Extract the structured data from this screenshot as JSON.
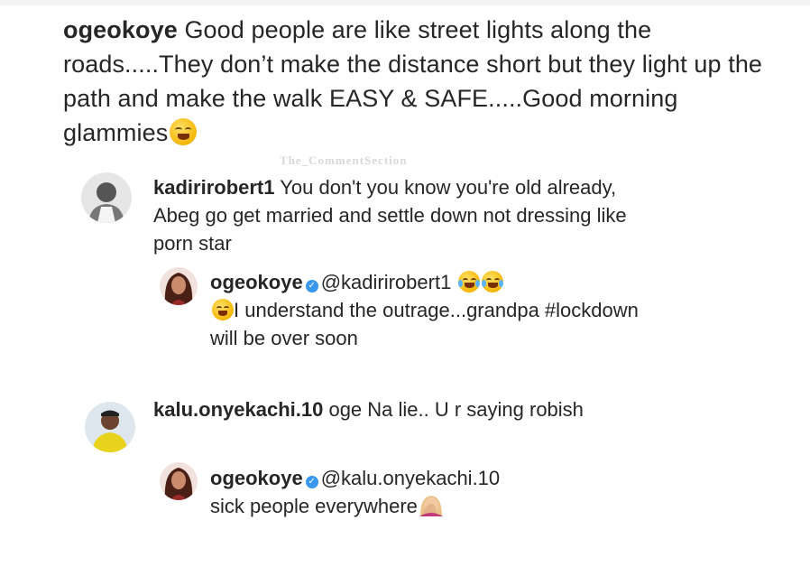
{
  "post": {
    "username": "ogeokoye",
    "caption": "Good people are like street lights along the roads.....They don’t make the distance short but they light up the path and make the walk EASY & SAFE.....Good morning glammies"
  },
  "watermark": "The_CommentSection",
  "comments": [
    {
      "username": "kadirirobert1",
      "text": "You don't you know you're old already, Abeg go get married and settle down not dressing like porn star",
      "reply": {
        "username": "ogeokoye",
        "mention": "@kadirirobert1",
        "text": "I understand the outrage...grandpa #lockdown will be over soon"
      }
    },
    {
      "username": "kalu.onyekachi.10",
      "text": "oge Na lie.. U r saying robish",
      "reply": {
        "username": "ogeokoye",
        "mention": "@kalu.onyekachi.10",
        "text": "sick people everywhere"
      }
    }
  ],
  "icons": {
    "verified": "verified-badge-icon",
    "laughing": "laughing-emoji",
    "tears_of_joy": "tears-of-joy-emoji",
    "facepalm": "facepalm-emoji"
  },
  "colors": {
    "text": "#262626",
    "verified": "#3897f0",
    "background": "#ffffff"
  }
}
